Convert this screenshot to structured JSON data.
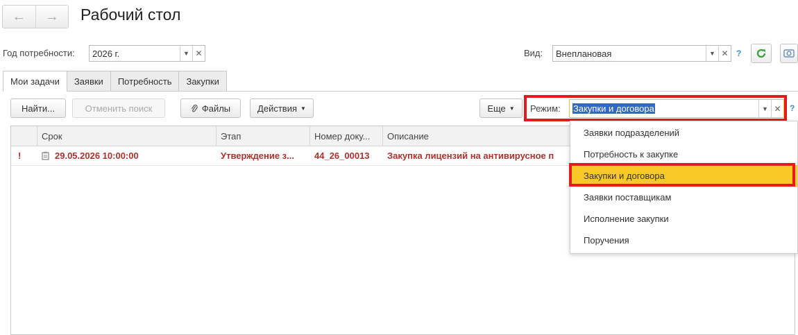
{
  "header": {
    "back_arrow": "←",
    "forward_arrow": "→",
    "title": "Рабочий стол"
  },
  "filters": {
    "year_label": "Год потребности:",
    "year_value": "2026 г.",
    "view_label": "Вид:",
    "view_value": "Внеплановая",
    "help": "?"
  },
  "tabs": [
    "Мои задачи",
    "Заявки",
    "Потребность",
    "Закупки"
  ],
  "toolbar": {
    "find": "Найти...",
    "cancel_search": "Отменить поиск",
    "files": "Файлы",
    "actions": "Действия",
    "more": "Еще",
    "mode_label": "Режим:",
    "mode_value": "Закупки и договора",
    "help": "?"
  },
  "grid": {
    "columns": [
      "",
      "Срок",
      "Этап",
      "Номер доку...",
      "Описание"
    ],
    "rows": [
      {
        "flag": "!",
        "deadline": "29.05.2026 10:00:00",
        "stage": "Утверждение з...",
        "number": "44_26_00013",
        "description": "Закупка лицензий на антивирусное п"
      }
    ]
  },
  "mode_dropdown": {
    "options": [
      "Заявки подразделений",
      "Потребность к закупке",
      "Закупки и договора",
      "Заявки поставщикам",
      "Исполнение закупки",
      "Поручения"
    ],
    "selected_index": 2
  },
  "colors": {
    "highlight_red": "#e31b1b",
    "selected_yellow": "#f8c927",
    "urgent_text": "#b0302b",
    "refresh_green": "#3fa346",
    "help_blue": "#3a8fd6"
  },
  "icons": {
    "back": "arrow-left-icon",
    "forward": "arrow-right-icon",
    "refresh": "refresh-icon",
    "camera": "camera-icon",
    "paperclip": "paperclip-icon",
    "task": "clipboard-icon"
  }
}
